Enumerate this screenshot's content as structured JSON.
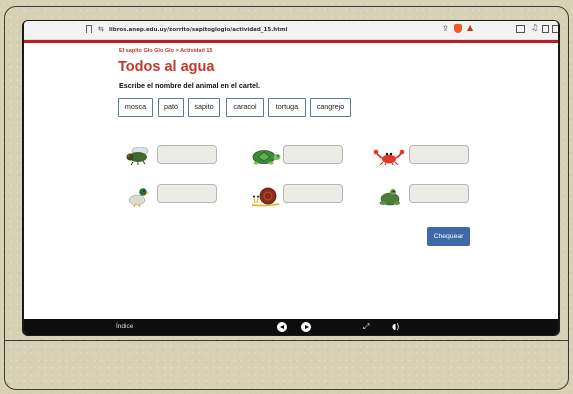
{
  "browser": {
    "url": "libros.anep.edu.uy/zorrito/sapitoglogio/actividad_15.html"
  },
  "page": {
    "breadcrumb": "El sapito Glo Glo Glo > Actividad 15",
    "title": "Todos al agua",
    "instruction": "Escribe el nombre del animal en el cartel."
  },
  "words": [
    "mosca",
    "pato",
    "sapito",
    "caracol",
    "tortuga",
    "cangrejo"
  ],
  "animals": [
    "fly",
    "turtle",
    "crab",
    "duck",
    "snail",
    "frog"
  ],
  "check_label": "Chequear",
  "footer": {
    "index_label": "Índice"
  },
  "colors": {
    "accent": "#b71f24",
    "button": "#3f69a8",
    "chip_border": "#5b7f8a"
  }
}
